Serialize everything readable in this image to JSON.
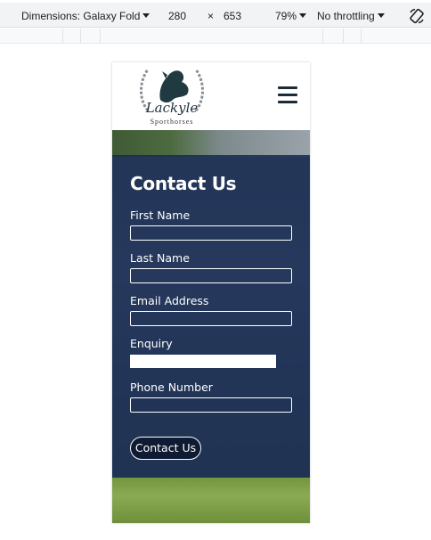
{
  "devtools": {
    "dimensions_label": "Dimensions: Galaxy Fold",
    "width": "280",
    "times": "×",
    "height": "653",
    "zoom": "79%",
    "throttling": "No throttling"
  },
  "site": {
    "logo_text": "Lackyle",
    "logo_subtext": "Sporthorses"
  },
  "form": {
    "title": "Contact Us",
    "fields": [
      {
        "label": "First Name",
        "value": ""
      },
      {
        "label": "Last Name",
        "value": ""
      },
      {
        "label": "Email Address",
        "value": ""
      },
      {
        "label": "Enquiry",
        "value": ""
      },
      {
        "label": "Phone Number",
        "value": ""
      }
    ],
    "submit_label": "Contact Us"
  },
  "colors": {
    "panel": "#162a50",
    "button": "#0f1b33",
    "hamburger": "#1d2a3a"
  }
}
